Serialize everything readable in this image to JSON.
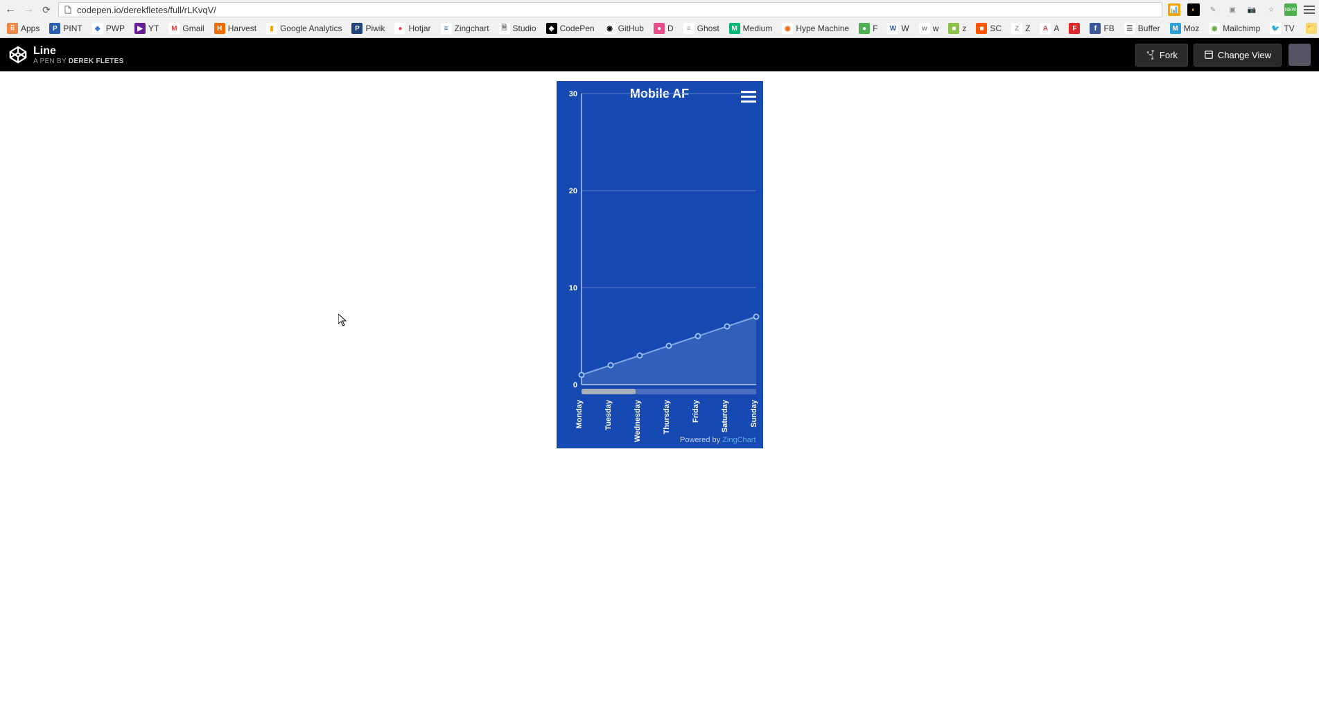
{
  "browser": {
    "url": "codepen.io/derekfletes/full/rLKvqV/"
  },
  "bookmarks": [
    {
      "label": "Apps",
      "bg": "#e84",
      "fg": "#fff",
      "glyph": "⠿"
    },
    {
      "label": "PINT",
      "bg": "#2a5db0",
      "fg": "#fff",
      "glyph": "P"
    },
    {
      "label": "PWP",
      "bg": "#fff",
      "fg": "#3b76d6",
      "glyph": "◆"
    },
    {
      "label": "YT",
      "bg": "#6a1b9a",
      "fg": "#fff",
      "glyph": "▶"
    },
    {
      "label": "Gmail",
      "bg": "#fff",
      "fg": "#d44",
      "glyph": "M"
    },
    {
      "label": "Harvest",
      "bg": "#f36c00",
      "fg": "#fff",
      "glyph": "H"
    },
    {
      "label": "Google Analytics",
      "bg": "#fff",
      "fg": "#f7a500",
      "glyph": "▮"
    },
    {
      "label": "Piwik",
      "bg": "#1f447e",
      "fg": "#fff",
      "glyph": "P"
    },
    {
      "label": "Hotjar",
      "bg": "#fff",
      "fg": "#fd3a5c",
      "glyph": "●"
    },
    {
      "label": "Zingchart",
      "bg": "#fff",
      "fg": "#0b62a4",
      "glyph": "≡"
    },
    {
      "label": "Studio",
      "bg": "#fff",
      "fg": "#888",
      "glyph": "🗎"
    },
    {
      "label": "CodePen",
      "bg": "#000",
      "fg": "#fff",
      "glyph": "◈"
    },
    {
      "label": "GitHub",
      "bg": "#fff",
      "fg": "#000",
      "glyph": "◉"
    },
    {
      "label": "D",
      "bg": "#ea4c89",
      "fg": "#fff",
      "glyph": "●"
    },
    {
      "label": "Ghost",
      "bg": "#fff",
      "fg": "#999",
      "glyph": "≡"
    },
    {
      "label": "Medium",
      "bg": "#02b875",
      "fg": "#fff",
      "glyph": "M"
    },
    {
      "label": "Hype Machine",
      "bg": "#fff",
      "fg": "#e61",
      "glyph": "◉"
    },
    {
      "label": "F",
      "bg": "#4caf50",
      "fg": "#fff",
      "glyph": "●"
    },
    {
      "label": "W",
      "bg": "#fff",
      "fg": "#2a5db0",
      "glyph": "W"
    },
    {
      "label": "w",
      "bg": "#fff",
      "fg": "#888",
      "glyph": "w"
    },
    {
      "label": "z",
      "bg": "#8bc34a",
      "fg": "#fff",
      "glyph": "■"
    },
    {
      "label": "SC",
      "bg": "#f50",
      "fg": "#fff",
      "glyph": "■"
    },
    {
      "label": "Z",
      "bg": "#fff",
      "fg": "#999",
      "glyph": "Z"
    },
    {
      "label": "A",
      "bg": "#fff",
      "fg": "#c44",
      "glyph": "A"
    },
    {
      "label": "",
      "bg": "#e12828",
      "fg": "#fff",
      "glyph": "F"
    },
    {
      "label": "FB",
      "bg": "#3b5998",
      "fg": "#fff",
      "glyph": "f"
    },
    {
      "label": "Buffer",
      "bg": "#fff",
      "fg": "#333",
      "glyph": "☰"
    },
    {
      "label": "Moz",
      "bg": "#29a0d8",
      "fg": "#fff",
      "glyph": "M"
    },
    {
      "label": "Mailchimp",
      "bg": "#fff",
      "fg": "#6a4",
      "glyph": "◉"
    },
    {
      "label": "TV",
      "bg": "#fff",
      "fg": "#1da1f2",
      "glyph": "🐦"
    }
  ],
  "other_bookmarks_label": "Other bookmarks",
  "codepen": {
    "title": "Line",
    "byline_prefix": "A PEN BY ",
    "author": "Derek Fletes",
    "fork_label": "Fork",
    "change_view_label": "Change View"
  },
  "chart": {
    "title": "Mobile AF",
    "footer_prefix": "Powered by ",
    "footer_link": "ZingChart"
  },
  "chart_data": {
    "type": "area",
    "categories": [
      "Monday",
      "Tuesday",
      "Wednesday",
      "Thursday",
      "Friday",
      "Saturday",
      "Sunday"
    ],
    "values": [
      1,
      2,
      3,
      4,
      5,
      6,
      7
    ],
    "y_ticks": [
      0,
      10,
      20,
      30
    ],
    "ylim": [
      0,
      30
    ],
    "title": "Mobile AF"
  }
}
